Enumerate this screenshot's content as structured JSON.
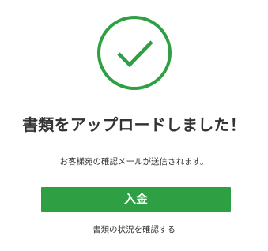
{
  "page": {
    "heading": "書類をアップロードしました！",
    "message": "お客様宛の確認メールが送信されます。",
    "primary_button_label": "入金",
    "secondary_link_label": "書類の状況を確認する"
  },
  "icons": {
    "success": "check-circle-icon"
  },
  "colors": {
    "accent": "#2ea043",
    "text": "#333333",
    "background": "#ffffff"
  }
}
